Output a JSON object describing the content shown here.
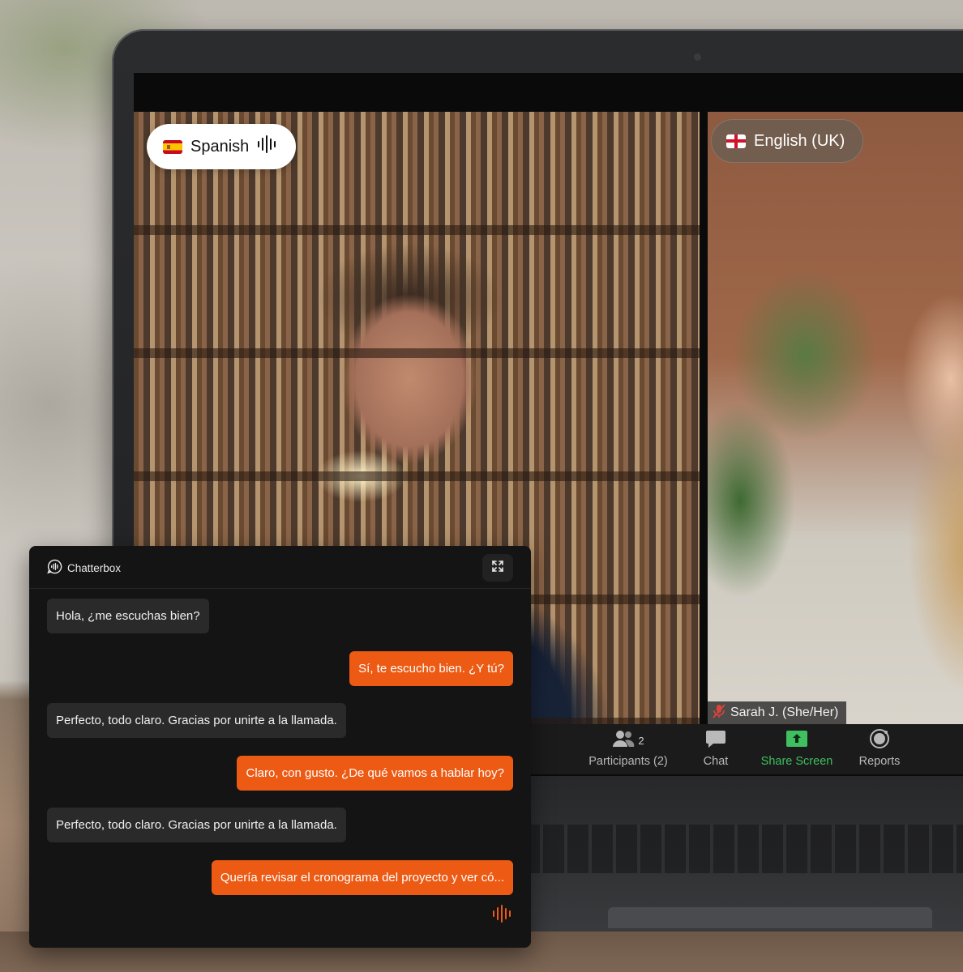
{
  "meeting": {
    "tiles": [
      {
        "language_label": "Spanish",
        "flag": "spain-flag",
        "audio_icon": "audio-wave-icon"
      },
      {
        "language_label": "English (UK)",
        "flag": "england-flag",
        "participant_name": "Sarah J. (She/Her)",
        "muted_icon": "mic-muted-icon"
      }
    ],
    "toolbar": {
      "participants": {
        "label": "Participants (2)",
        "count": "2",
        "icon": "participants-icon"
      },
      "chat": {
        "label": "Chat",
        "icon": "chat-bubble-icon"
      },
      "share_screen": {
        "label": "Share Screen",
        "icon": "share-screen-icon",
        "color": "#3fbf5f"
      },
      "reports": {
        "label": "Reports",
        "icon": "reports-icon"
      }
    }
  },
  "chat_panel": {
    "brand": "Chatterbox",
    "expand_icon": "expand-icon",
    "accent_color": "#ec5a14",
    "messages": [
      {
        "side": "in",
        "text": "Hola, ¿me escuchas bien?"
      },
      {
        "side": "out",
        "text": "Sí, te escucho bien. ¿Y tú?"
      },
      {
        "side": "in",
        "text": "Perfecto, todo claro. Gracias por unirte a la llamada."
      },
      {
        "side": "out",
        "text": "Claro, con gusto. ¿De qué vamos a hablar hoy?"
      },
      {
        "side": "in",
        "text": "Perfecto, todo claro. Gracias por unirte a la llamada."
      },
      {
        "side": "out",
        "text": "Quería revisar el cronograma del proyecto y ver có..."
      }
    ],
    "typing_indicator_icon": "speaking-wave-icon"
  }
}
